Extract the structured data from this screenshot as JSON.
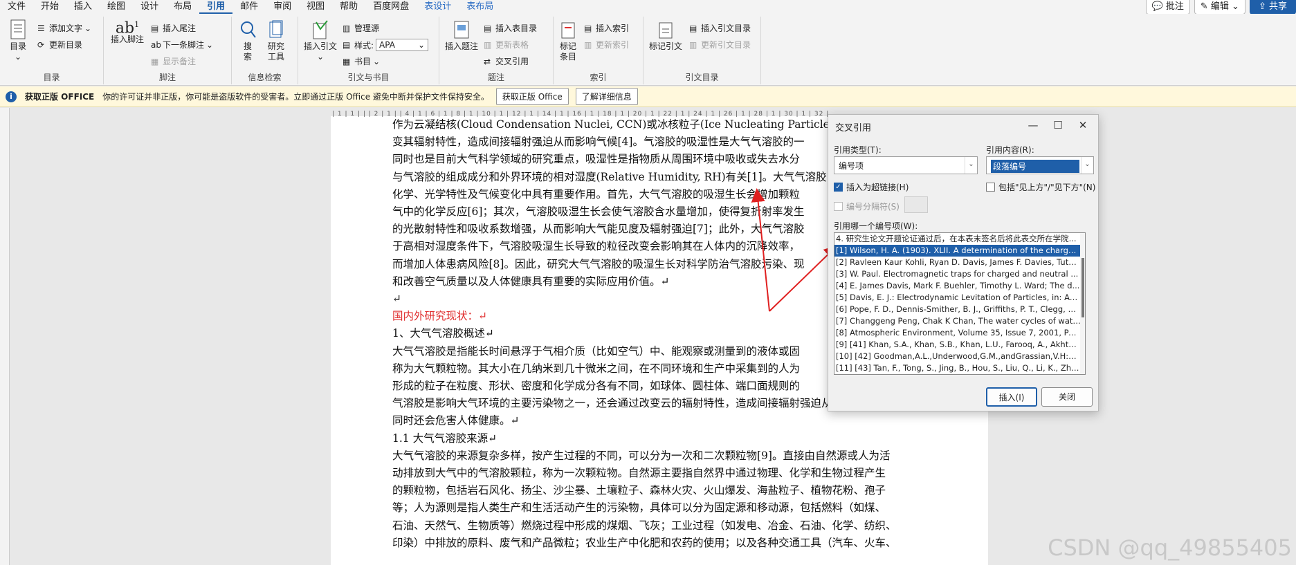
{
  "menubar": {
    "items": [
      "文件",
      "开始",
      "插入",
      "绘图",
      "设计",
      "布局",
      "引用",
      "邮件",
      "审阅",
      "视图",
      "帮助",
      "百度网盘",
      "表设计",
      "表布局"
    ],
    "active": "引用",
    "comments": "批注",
    "editing": "编辑",
    "share": "共享"
  },
  "ribbon": {
    "toc_group": {
      "label": "目录",
      "toc_button": "目录",
      "add_text": "添加文字",
      "update_toc": "更新目录"
    },
    "footnote_group": {
      "label": "脚注",
      "insert_footnote": "插入脚注",
      "insert_endnote": "插入尾注",
      "next_footnote": "下一条脚注",
      "show_notes": "显示备注"
    },
    "research_group": {
      "label": "信息检索",
      "search": "搜索",
      "researcher": "研究工具"
    },
    "citation_group": {
      "label": "引文与书目",
      "insert_citation": "插入引文",
      "manage_sources": "管理源",
      "style_label": "样式:",
      "style_value": "APA",
      "bibliography": "书目"
    },
    "caption_group": {
      "label": "题注",
      "insert_caption": "插入题注",
      "insert_table_of_figures": "插入表目录",
      "update_table": "更新表格",
      "cross_reference": "交叉引用"
    },
    "index_group": {
      "label": "索引",
      "mark_entry": "标记条目",
      "insert_index": "插入索引",
      "update_index": "更新索引"
    },
    "authorities_group": {
      "label": "引文目录",
      "mark_citation": "标记引文",
      "insert_toa": "插入引文目录",
      "update_toa": "更新引文目录"
    }
  },
  "infobar": {
    "title": "获取正版 OFFICE",
    "message": "你的许可证并非正版，你可能是盗版软件的受害者。立即通过正版 Office 避免中断并保护文件保持安全。",
    "get_genuine": "获取正版 Office",
    "learn_more": "了解详细信息"
  },
  "ruler": {
    "ticks": "| 1 | 1 | | | 2 | 1 | | 4 | 1 | 6 | 1 | 8 | 1 | 10 | 1 | 12 | 1 | 14 | 1 | 16 | 1 | 18 | 1 | 20 | 1 | 22 | 1 | 24 | 1 | 26 | 1 | 28 | 1 | 30 | 1 | 32 | 1 | 34 | 1 | 36 |"
  },
  "document": {
    "lines": [
      "作为云凝结核(Cloud Condensation Nuclei, CCN)或冰核粒子(Ice Nucleating Particles, INPs",
      "变其辐射特性，造成间接辐射强迫从而影响气候[4]。气溶胶的吸湿性是大气气溶胶的一",
      "同时也是目前大气科学领域的研究重点，吸湿性是指物质从周围环境中吸收或失去水分",
      "与气溶胶的组成成分和外界环境的相对湿度(Relative Humidity, RH)有关[1]。大气气溶胶",
      "化学、光学特性及气候变化中具有重要作用。首先，大气气溶胶的吸湿生长会增加颗粒",
      "气中的化学反应[6]；其次，气溶胶吸湿生长会使气溶胶含水量增加，使得复折射率发生",
      "的光散射特性和吸收系数增强，从而影响大气能见度及辐射强迫[7]；此外，大气气溶胶",
      "于高相对湿度条件下，气溶胶吸湿生长导致的粒径改变会影响其在人体内的沉降效率，",
      "而增加人体患病风险[8]。因此，研究大气气溶胶的吸湿生长对科学防治气溶胶污染、现",
      "和改善空气质量以及人体健康具有重要的实际应用价值。↵",
      "↵",
      "国内外研究现状：↵",
      "1、大气气溶胶概述↵",
      "大气气溶胶是指能长时间悬浮于气相介质（比如空气）中、能观察或测量到的液体或固",
      "称为大气颗粒物。其大小在几纳米到几十微米之间，在不同环境和生产中采集到的人为",
      "形成的粒子在粒度、形状、密度和化学成分各有不同，如球体、圆柱体、端口面规则的",
      "气溶胶是影响大气环境的主要污染物之一，还会通过改变云的辐射特性，造成间接辐射强迫从而影响气候，",
      "同时还会危害人体健康。↵",
      "1.1  大气气溶胶来源↵",
      "大气气溶胶的来源复杂多样，按产生过程的不同，可以分为一次和二次颗粒物[9]。直接由自然源或人为活",
      "动排放到大气中的气溶胶颗粒，称为一次颗粒物。自然源主要指自然界中通过物理、化学和生物过程产生",
      "的颗粒物，包括岩石风化、扬尘、沙尘暴、土壤粒子、森林火灾、火山爆发、海盐粒子、植物花粉、孢子",
      "等；人为源则是指人类生产和生活活动产生的污染物，具体可以分为固定源和移动源，包括燃料（如煤、",
      "石油、天然气、生物质等）燃烧过程中形成的煤烟、飞灰；工业过程（如发电、冶金、石油、化学、纺织、",
      "印染）中排放的原料、废气和产品微粒；农业生产中化肥和农药的使用；以及各种交通工具（汽车、火车、"
    ]
  },
  "dialog": {
    "title": "交叉引用",
    "ref_type_label": "引用类型(T):",
    "ref_type_value": "编号项",
    "ref_content_label": "引用内容(R):",
    "ref_content_value": "段落编号",
    "insert_hyperlink": "插入为超链接(H)",
    "include_above_below": "包括\"见上方\"/\"见下方\"(N)",
    "separate_numbers": "编号分隔符(S)",
    "which_item_label": "引用哪一个编号项(W):",
    "items": [
      "4. 研究生论文开题论证通过后，在本表末签名后将此表交所在学院...",
      "[1] Wilson, H. A. (1903). XLII. A determination of the charge ...",
      "[2] Ravleen Kaur Kohli, Ryan D. Davis, James F. Davies, Tutor...",
      "[3] W. Paul. Electromagnetic traps for charged and neutral ...",
      "[4] E. James Davis, Mark F. Buehler, Timothy L. Ward; The d...",
      "[5] Davis, E. J.: Electrodynamic Levitation of Particles, in: Aer...",
      "[6] Pope, F. D., Dennis-Smither, B. J., Griffiths, P. T., Clegg, S....",
      "[7] Changgeng Peng, Chak K Chan, The water cycles of wate...",
      "[8] Atmospheric Environment, Volume 35, Issue 7, 2001, Pag...",
      "[9] [41] Khan, S.A., Khan, S.B., Khan, L.U., Farooq, A., Akhtar, ...",
      "[10] [42] Goodman,A.L.,Underwood,G.M.,andGrassian,V.H:A...",
      "[11] [43] Tan, F., Tong, S., Jing, B., Hou, S., Liu, Q., Li, K., Zha..."
    ],
    "selected_index": 1,
    "insert_button": "插入(I)",
    "close_button": "关闭"
  },
  "watermark": "CSDN @qq_49855405",
  "colors": {
    "accent": "#1f5fa9",
    "heading_red": "#e03030",
    "arrow_red": "#e02020",
    "infobar_bg": "#fff8dc"
  }
}
